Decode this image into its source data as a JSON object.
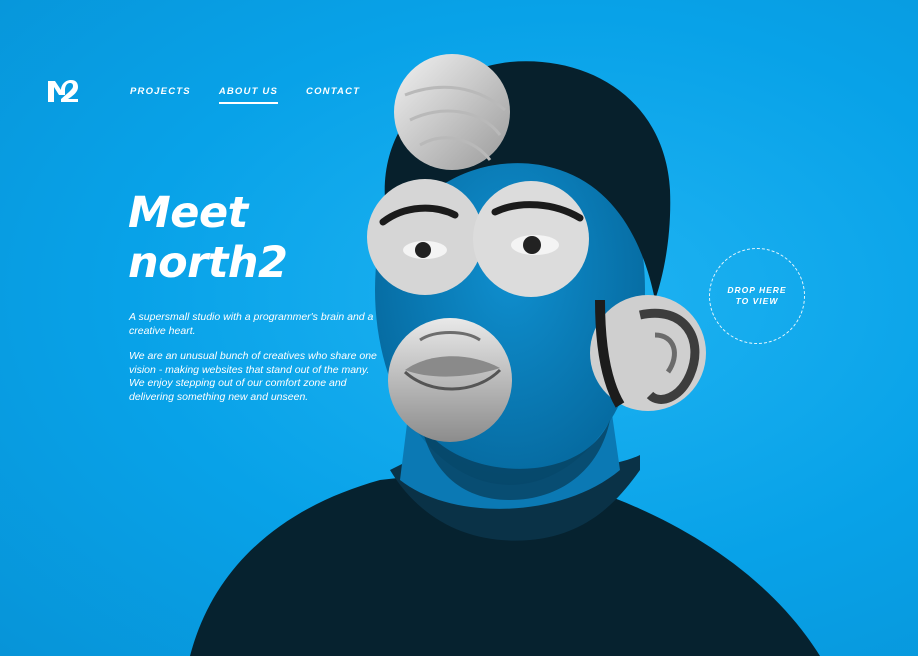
{
  "brand": {
    "logo_icon": "north2-logo-icon",
    "accent": "#0aa5ea",
    "text_color": "#ffffff"
  },
  "nav": {
    "items": [
      {
        "label": "PROJECTS",
        "active": false
      },
      {
        "label": "ABOUT US",
        "active": true
      },
      {
        "label": "CONTACT",
        "active": false
      }
    ]
  },
  "hero": {
    "headline_line1": "Meet",
    "headline_line2": "north2",
    "intro": "A supersmall studio with a programmer's brain and a creative heart.",
    "body": "We are an unusual bunch of creatives who share one vision - making websites that stand out of the many. We enjoy stepping out of our comfort zone and delivering something new and unseen."
  },
  "drop_zone": {
    "label": "DROP HERE TO VIEW"
  }
}
